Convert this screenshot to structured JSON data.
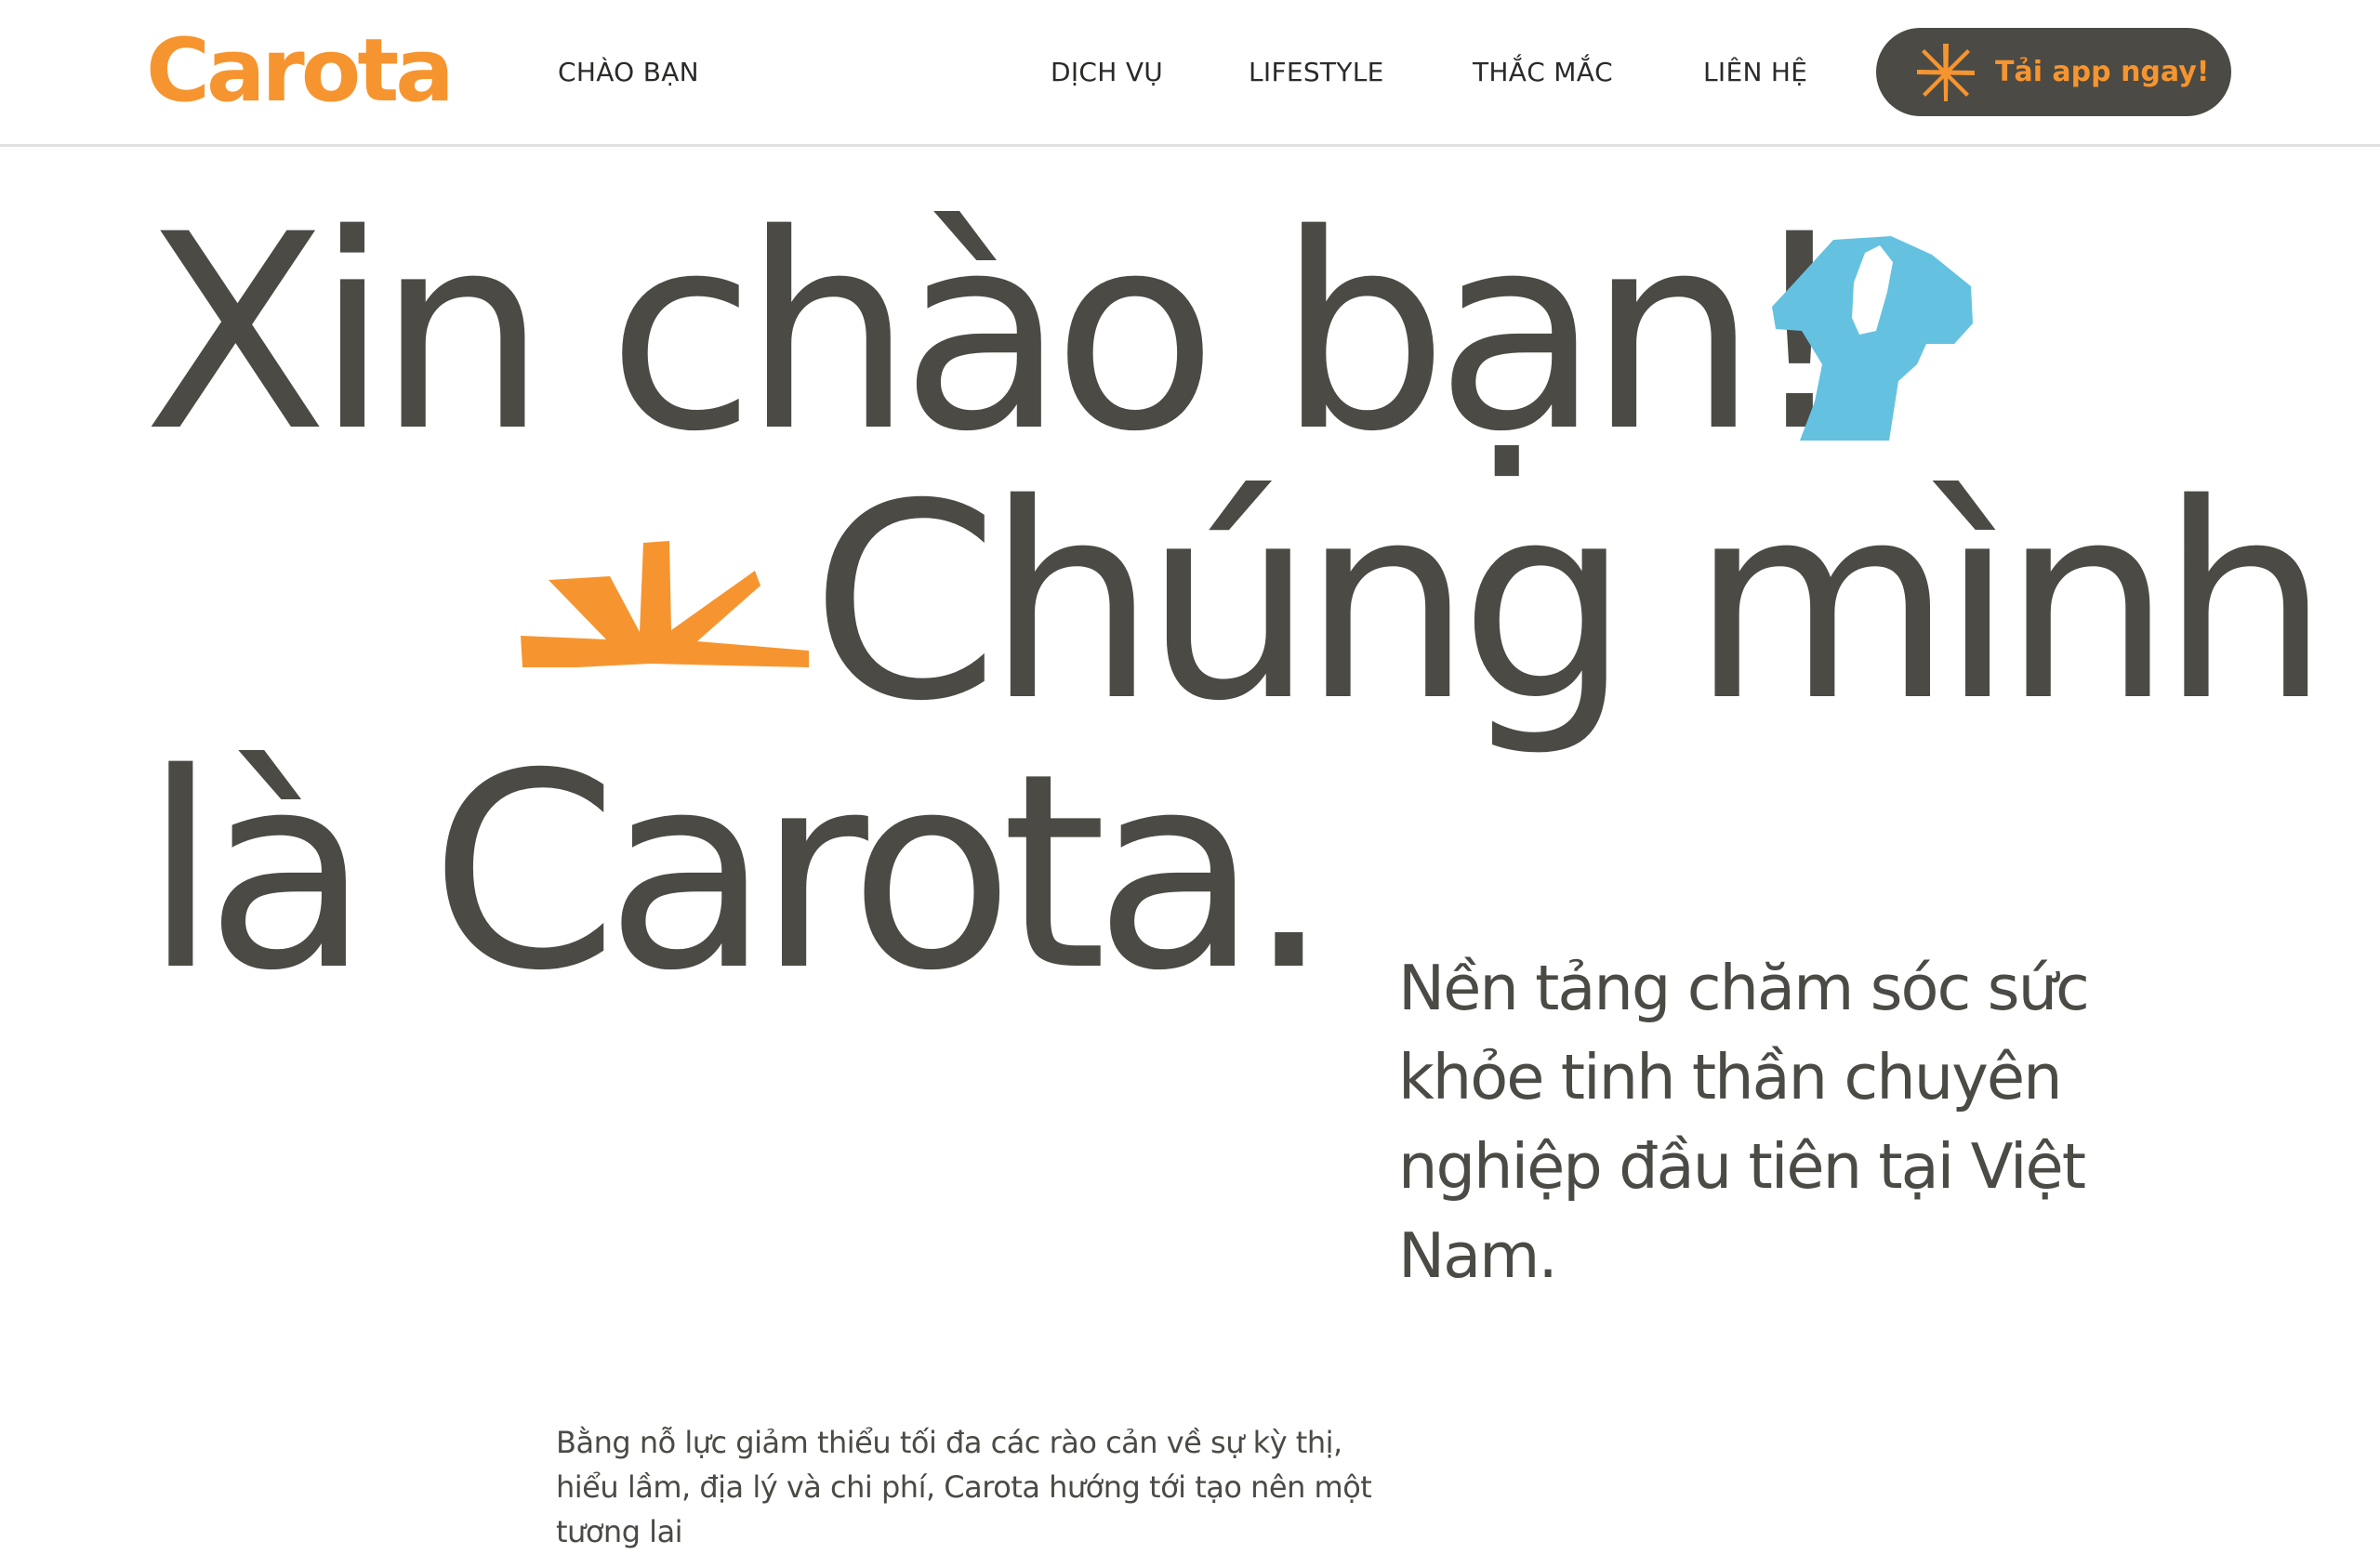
{
  "header": {
    "logo": "Carota",
    "nav": {
      "chao_ban": "CHÀO BẠN",
      "dich_vu": "DỊCH VỤ",
      "lifestyle": "LIFESTYLE",
      "thac_mac": "THẮC MẮC",
      "lien_he": "LIÊN HỆ"
    },
    "cta_label": "Tải app ngay!"
  },
  "hero": {
    "line1": "Xin chào bạn!",
    "line2": "Chúng mình",
    "line3": "là Carota."
  },
  "tagline": "Nền tảng chăm sóc sức khỏe tinh thần chuyên nghiệp đầu tiên tại Việt Nam.",
  "description": "Bằng nỗ lực giảm thiểu tối đa các rào cản về sự kỳ thị, hiểu lầm, địa lý và chi phí, Carota hướng tới tạo nên một tương lai",
  "colors": {
    "brand_orange": "#f6952f",
    "text_dark": "#4b4a45",
    "accent_blue": "#65c1e0",
    "button_bg": "#4b4a45"
  },
  "icons": {
    "cta": "orange-star-icon",
    "hero_decor_1": "blue-figure-illustration",
    "hero_decor_2": "orange-sunburst-illustration"
  }
}
